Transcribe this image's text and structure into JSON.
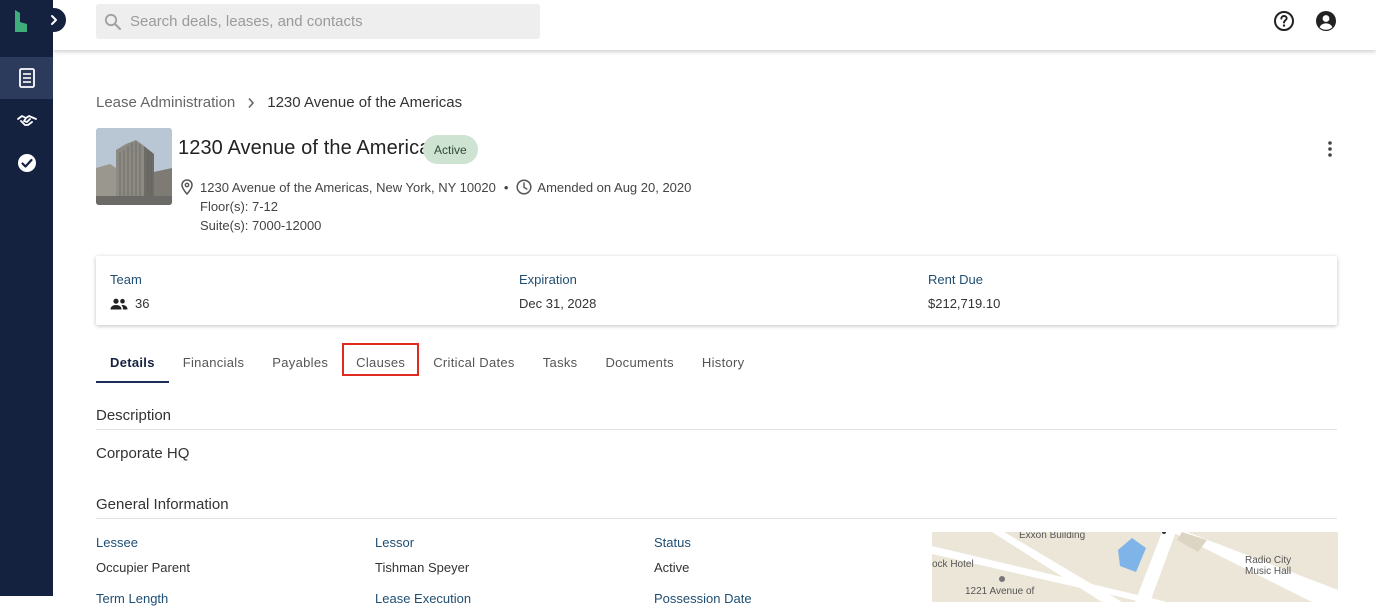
{
  "search": {
    "placeholder": "Search deals, leases, and contacts"
  },
  "breadcrumb": {
    "parent": "Lease Administration",
    "current": "1230 Avenue of the Americas"
  },
  "header": {
    "title": "1230 Avenue of the Americas",
    "status_badge": "Active",
    "address": "1230 Avenue of the Americas, New York, NY 10020",
    "separator": "•",
    "amended": "Amended on Aug 20, 2020",
    "floors": "Floor(s): 7-12",
    "suites": "Suite(s): 7000-12000"
  },
  "summary": {
    "team_label": "Team",
    "team_value": "36",
    "expiration_label": "Expiration",
    "expiration_value": "Dec 31, 2028",
    "rent_label": "Rent Due",
    "rent_value": "$212,719.10"
  },
  "tabs": [
    {
      "label": "Details",
      "active": true
    },
    {
      "label": "Financials"
    },
    {
      "label": "Payables"
    },
    {
      "label": "Clauses",
      "highlighted": true
    },
    {
      "label": "Critical Dates"
    },
    {
      "label": "Tasks"
    },
    {
      "label": "Documents"
    },
    {
      "label": "History"
    }
  ],
  "description": {
    "title": "Description",
    "value": "Corporate HQ"
  },
  "general_info": {
    "title": "General Information",
    "lessee_label": "Lessee",
    "lessee_value": "Occupier Parent",
    "lessor_label": "Lessor",
    "lessor_value": "Tishman Speyer",
    "status_label": "Status",
    "status_value": "Active",
    "term_length_label": "Term Length",
    "lease_execution_label": "Lease Execution",
    "possession_date_label": "Possession Date"
  },
  "map": {
    "label_exxon": "Exxon Building",
    "label_hotel": "ock Hotel",
    "label_radio": "Radio City\nMusic Hall",
    "label_1221": "1221 Avenue of"
  },
  "colors": {
    "sidebar": "#14213f",
    "accent_green": "#3fae7a",
    "label_blue": "#1f4e72",
    "highlight_red": "#e0291f",
    "badge_bg": "#cfe3d2"
  }
}
